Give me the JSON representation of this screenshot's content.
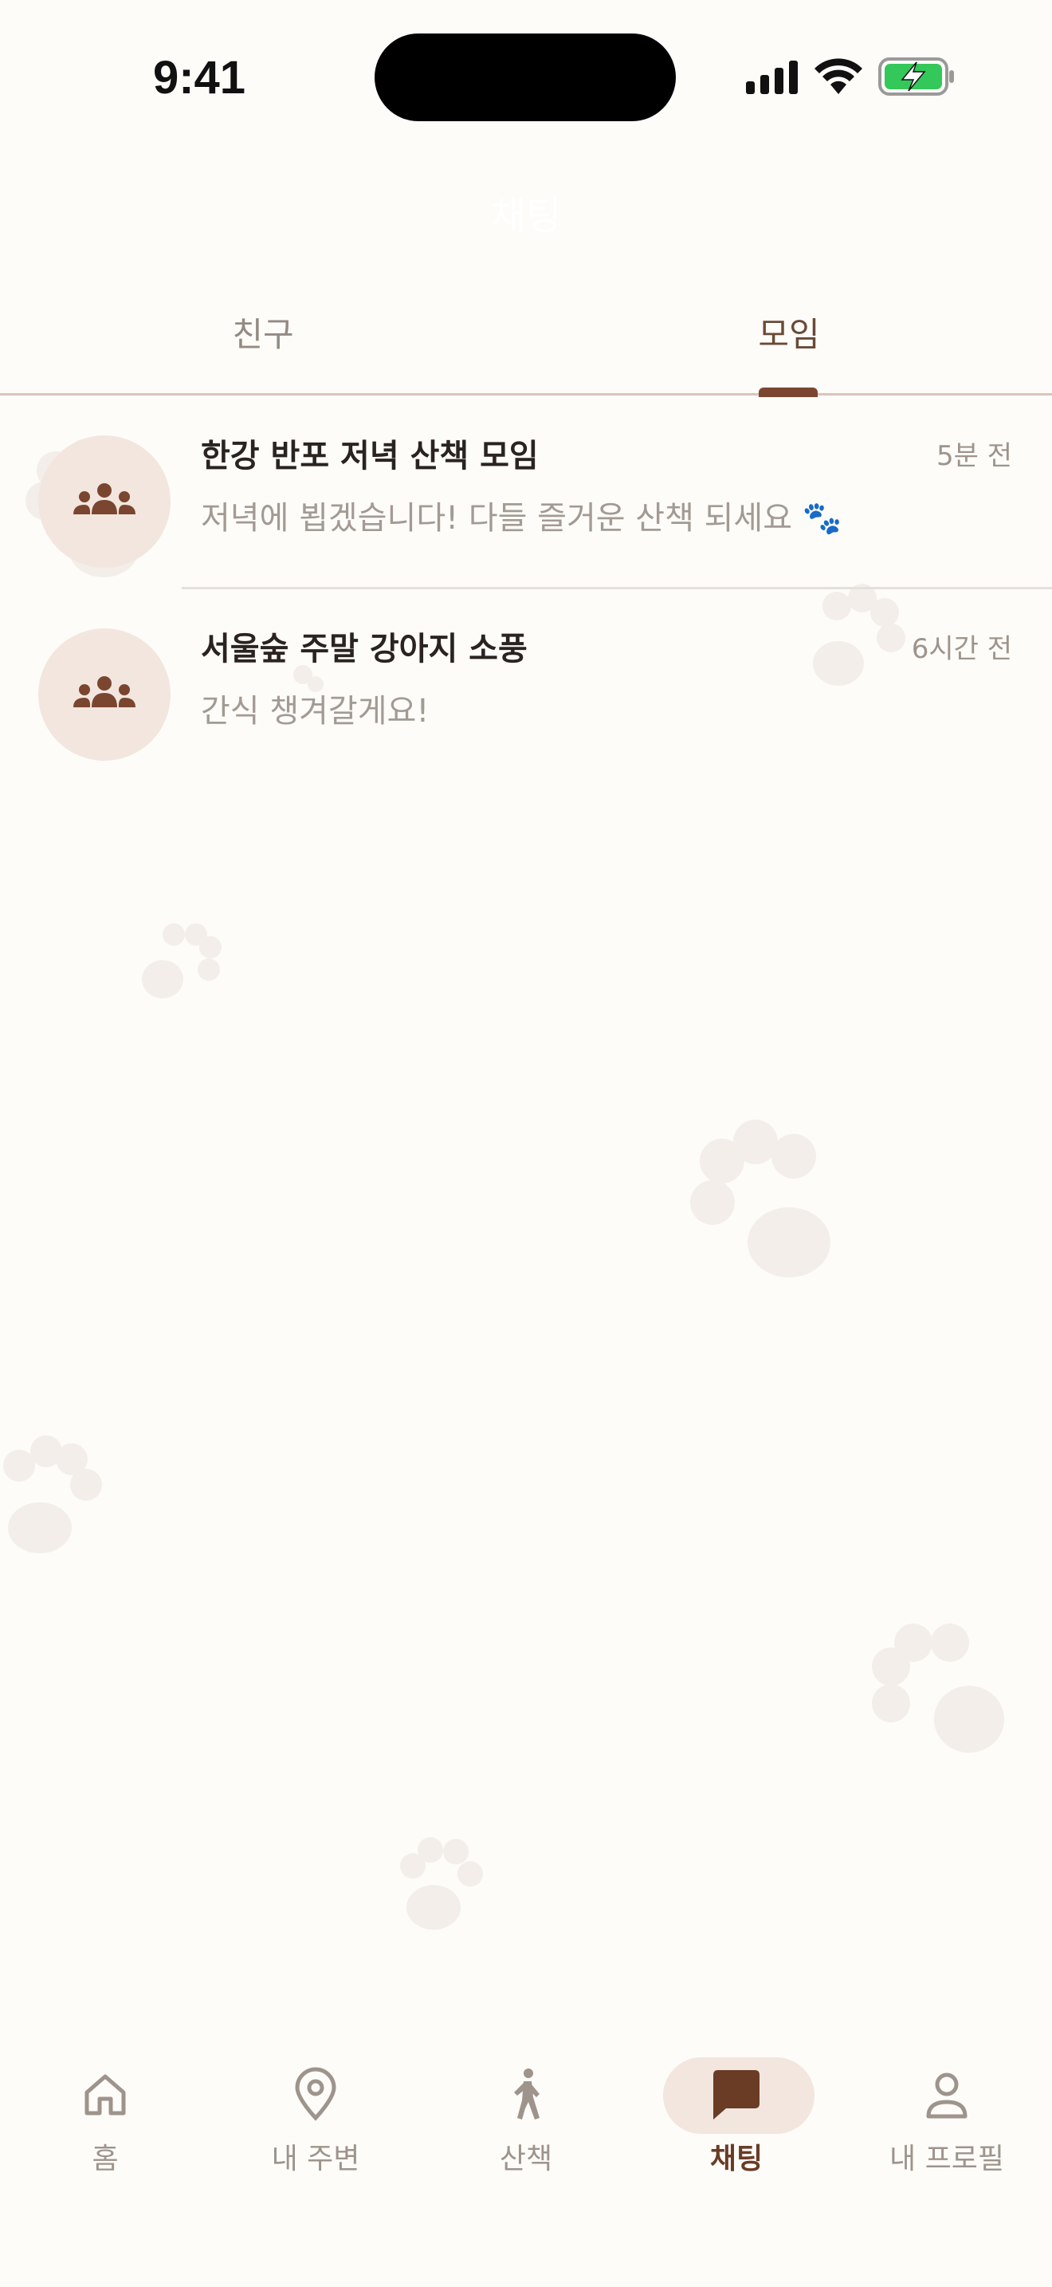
{
  "status_bar": {
    "time": "9:41"
  },
  "header": {
    "title": "채팅"
  },
  "tabs": [
    {
      "label": "친구",
      "active": false
    },
    {
      "label": "모임",
      "active": true
    }
  ],
  "chats": [
    {
      "title": "한강 반포 저녁 산책 모임",
      "time": "5분 전",
      "message": "저녁에 뵙겠습니다! 다들 즐거운 산책 되세요 🐾",
      "icon": "group-icon"
    },
    {
      "title": "서울숲 주말 강아지 소풍",
      "time": "6시간 전",
      "message": "간식 챙겨갈게요!",
      "icon": "group-icon"
    }
  ],
  "nav": [
    {
      "label": "홈",
      "icon": "home-icon",
      "active": false
    },
    {
      "label": "내 주변",
      "icon": "location-pin-icon",
      "active": false
    },
    {
      "label": "산책",
      "icon": "walking-icon",
      "active": false
    },
    {
      "label": "채팅",
      "icon": "chat-bubble-icon",
      "active": true
    },
    {
      "label": "내 프로필",
      "icon": "person-icon",
      "active": false
    }
  ],
  "colors": {
    "background": "#fdfcf9",
    "accent": "#6a3c25",
    "tab_indicator": "#7a4630",
    "avatar_bg": "#f2e6df",
    "muted_text": "#9e948c"
  }
}
